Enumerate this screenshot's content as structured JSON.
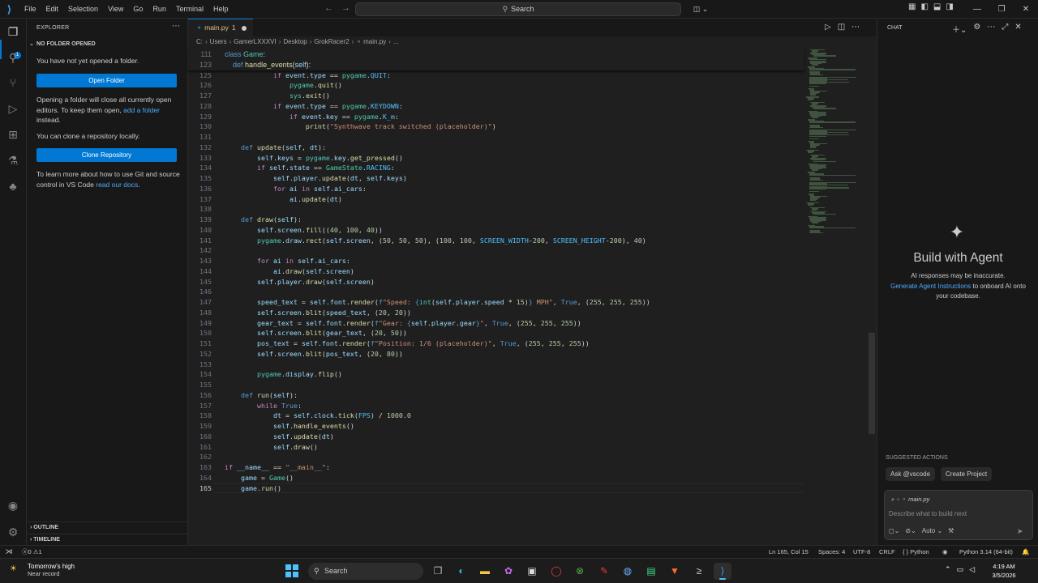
{
  "titlebar": {
    "menu": [
      "File",
      "Edit",
      "Selection",
      "View",
      "Go",
      "Run",
      "Terminal",
      "Help"
    ],
    "search_label": "Search"
  },
  "explorer": {
    "title": "EXPLORER",
    "section": "NO FOLDER OPENED",
    "msg1": "You have not yet opened a folder.",
    "open_folder_button": "Open Folder",
    "msg2_pre": "Opening a folder will close all currently open editors. To keep them open, ",
    "msg2_link": "add a folder",
    "msg2_post": " instead.",
    "msg3": "You can clone a repository locally.",
    "clone_button": "Clone Repository",
    "msg4_pre": "To learn more about how to use Git and source control in VS Code ",
    "msg4_link": "read our docs",
    "msg4_post": ".",
    "outline": "OUTLINE",
    "timeline": "TIMELINE",
    "badge": "1"
  },
  "editor": {
    "tab_name": "main.py",
    "tab_problems": "1",
    "breadcrumb": [
      "C:",
      "Users",
      "GamerLXXXVI",
      "Desktop",
      "GrokRacer2",
      "main.py",
      "..."
    ],
    "sticky": [
      {
        "ln": "111",
        "html": "<span class='k'>class</span> <span class='cl'>Game</span>:"
      },
      {
        "ln": "123",
        "html": "    <span class='k'>def</span> <span class='fn'>handle_events</span>(<span class='v'>self</span>):"
      }
    ],
    "lines": [
      {
        "ln": "124",
        "html": ""
      },
      {
        "ln": "125",
        "html": "            <span class='kf'>if</span> <span class='v'>event</span>.<span class='v'>type</span> == <span class='cl'>pygame</span>.<span class='c'>QUIT</span>:"
      },
      {
        "ln": "126",
        "html": "                <span class='cl'>pygame</span>.<span class='fn'>quit</span>()"
      },
      {
        "ln": "127",
        "html": "                <span class='cl'>sys</span>.<span class='fn'>exit</span>()"
      },
      {
        "ln": "128",
        "html": "            <span class='kf'>if</span> <span class='v'>event</span>.<span class='v'>type</span> == <span class='cl'>pygame</span>.<span class='c'>KEYDOWN</span>:"
      },
      {
        "ln": "129",
        "html": "                <span class='kf'>if</span> <span class='v'>event</span>.<span class='v'>key</span> == <span class='cl'>pygame</span>.<span class='c'>K_m</span>:"
      },
      {
        "ln": "130",
        "html": "                    <span class='fn'>print</span>(<span class='s'>\"Synthwave track switched (placeholder)\"</span>)"
      },
      {
        "ln": "131",
        "html": ""
      },
      {
        "ln": "132",
        "html": "    <span class='k'>def</span> <span class='fn'>update</span>(<span class='v'>self</span>, <span class='v'>dt</span>):"
      },
      {
        "ln": "133",
        "html": "        <span class='v'>self</span>.<span class='v'>keys</span> = <span class='cl'>pygame</span>.<span class='v'>key</span>.<span class='fn'>get_pressed</span>()"
      },
      {
        "ln": "134",
        "html": "        <span class='kf'>if</span> <span class='v'>self</span>.<span class='v'>state</span> == <span class='cl'>GameState</span>.<span class='c'>RACING</span>:"
      },
      {
        "ln": "135",
        "html": "            <span class='v'>self</span>.<span class='v'>player</span>.<span class='fn'>update</span>(<span class='v'>dt</span>, <span class='v'>self</span>.<span class='v'>keys</span>)"
      },
      {
        "ln": "136",
        "html": "            <span class='kf'>for</span> <span class='v'>ai</span> <span class='kf'>in</span> <span class='v'>self</span>.<span class='v'>ai_cars</span>:"
      },
      {
        "ln": "137",
        "html": "                <span class='v'>ai</span>.<span class='fn'>update</span>(<span class='v'>dt</span>)"
      },
      {
        "ln": "138",
        "html": ""
      },
      {
        "ln": "139",
        "html": "    <span class='k'>def</span> <span class='fn'>draw</span>(<span class='v'>self</span>):"
      },
      {
        "ln": "140",
        "html": "        <span class='v'>self</span>.<span class='v'>screen</span>.<span class='fn'>fill</span>((<span class='n'>40</span>, <span class='n'>100</span>, <span class='n'>40</span>))"
      },
      {
        "ln": "141",
        "html": "        <span class='cl'>pygame</span>.<span class='v'>draw</span>.<span class='fn'>rect</span>(<span class='v'>self</span>.<span class='v'>screen</span>, (<span class='n'>50</span>, <span class='n'>50</span>, <span class='n'>50</span>), (<span class='n'>100</span>, <span class='n'>100</span>, <span class='c'>SCREEN_WIDTH</span>-<span class='n'>200</span>, <span class='c'>SCREEN_HEIGHT</span>-<span class='n'>200</span>), <span class='n'>40</span>)"
      },
      {
        "ln": "142",
        "html": ""
      },
      {
        "ln": "143",
        "html": "        <span class='kf'>for</span> <span class='v'>ai</span> <span class='kf'>in</span> <span class='v'>self</span>.<span class='v'>ai_cars</span>:"
      },
      {
        "ln": "144",
        "html": "            <span class='v'>ai</span>.<span class='fn'>draw</span>(<span class='v'>self</span>.<span class='v'>screen</span>)"
      },
      {
        "ln": "145",
        "html": "        <span class='v'>self</span>.<span class='v'>player</span>.<span class='fn'>draw</span>(<span class='v'>self</span>.<span class='v'>screen</span>)"
      },
      {
        "ln": "146",
        "html": ""
      },
      {
        "ln": "147",
        "html": "        <span class='v'>speed_text</span> = <span class='v'>self</span>.<span class='v'>font</span>.<span class='fn'>render</span>(<span class='k'>f</span><span class='s'>\"Speed: </span><span class='k'>{</span><span class='cl'>int</span>(<span class='v'>self</span>.<span class='v'>player</span>.<span class='v'>speed</span> * <span class='n'>15</span>)<span class='k'>}</span><span class='s'> MPH\"</span>, <span class='k'>True</span>, (<span class='n'>255</span>, <span class='n'>255</span>, <span class='n'>255</span>))"
      },
      {
        "ln": "148",
        "html": "        <span class='v'>self</span>.<span class='v'>screen</span>.<span class='fn'>blit</span>(<span class='v'>speed_text</span>, (<span class='n'>20</span>, <span class='n'>20</span>))"
      },
      {
        "ln": "149",
        "html": "        <span class='v'>gear_text</span> = <span class='v'>self</span>.<span class='v'>font</span>.<span class='fn'>render</span>(<span class='k'>f</span><span class='s'>\"Gear: </span><span class='k'>{</span><span class='v'>self</span>.<span class='v'>player</span>.<span class='v'>gear</span><span class='k'>}</span><span class='s'>\"</span>, <span class='k'>True</span>, (<span class='n'>255</span>, <span class='n'>255</span>, <span class='n'>255</span>))"
      },
      {
        "ln": "150",
        "html": "        <span class='v'>self</span>.<span class='v'>screen</span>.<span class='fn'>blit</span>(<span class='v'>gear_text</span>, (<span class='n'>20</span>, <span class='n'>50</span>))"
      },
      {
        "ln": "151",
        "html": "        <span class='v'>pos_text</span> = <span class='v'>self</span>.<span class='v'>font</span>.<span class='fn'>render</span>(<span class='k'>f</span><span class='s'>\"Position: 1/6 (placeholder)\"</span>, <span class='k'>True</span>, (<span class='n'>255</span>, <span class='n'>255</span>, <span class='n'>255</span>))"
      },
      {
        "ln": "152",
        "html": "        <span class='v'>self</span>.<span class='v'>screen</span>.<span class='fn'>blit</span>(<span class='v'>pos_text</span>, (<span class='n'>20</span>, <span class='n'>80</span>))"
      },
      {
        "ln": "153",
        "html": ""
      },
      {
        "ln": "154",
        "html": "        <span class='cl'>pygame</span>.<span class='v'>display</span>.<span class='fn'>flip</span>()"
      },
      {
        "ln": "155",
        "html": ""
      },
      {
        "ln": "156",
        "html": "    <span class='k'>def</span> <span class='fn'>run</span>(<span class='v'>self</span>):"
      },
      {
        "ln": "157",
        "html": "        <span class='kf'>while</span> <span class='k'>True</span>:"
      },
      {
        "ln": "158",
        "html": "            <span class='v'>dt</span> = <span class='v'>self</span>.<span class='v'>clock</span>.<span class='fn'>tick</span>(<span class='c'>FPS</span>) / <span class='n'>1000.0</span>"
      },
      {
        "ln": "159",
        "html": "            <span class='v'>self</span>.<span class='fn'>handle_events</span>()"
      },
      {
        "ln": "160",
        "html": "            <span class='v'>self</span>.<span class='fn'>update</span>(<span class='v'>dt</span>)"
      },
      {
        "ln": "161",
        "html": "            <span class='v'>self</span>.<span class='fn'>draw</span>()"
      },
      {
        "ln": "162",
        "html": ""
      },
      {
        "ln": "163",
        "html": "<span class='kf'>if</span> <span class='v'>__name__</span> == <span class='s'>\"__main__\"</span>:"
      },
      {
        "ln": "164",
        "html": "    <span class='v'>game</span> = <span class='cl'>Game</span>()"
      },
      {
        "ln": "165",
        "html": "    <span class='v'>game</span>.<span class='fn'>run</span>()"
      }
    ]
  },
  "chat": {
    "title": "CHAT",
    "heading": "Build with Agent",
    "desc1": "AI responses may be inaccurate.",
    "desc_link": "Generate Agent Instructions",
    "desc2": " to onboard AI onto your codebase.",
    "suggested_title": "SUGGESTED ACTIONS",
    "suggestions": [
      "Ask @vscode",
      "Create Project"
    ],
    "context_file": "main.py",
    "placeholder": "Describe what to build next",
    "mode": "Auto"
  },
  "status": {
    "problems_errors": "0",
    "problems_warnings": "1",
    "cursor": "Ln 165, Col 15",
    "spaces": "Spaces: 4",
    "encoding": "UTF-8",
    "eol": "CRLF",
    "language": "Python",
    "interpreter": "Python 3.14 (64-bit)"
  },
  "taskbar": {
    "weather_title": "Tomorrow's high",
    "weather_sub": "Near record",
    "search": "Search",
    "time": "4:19 AM",
    "date": "3/5/2026"
  }
}
